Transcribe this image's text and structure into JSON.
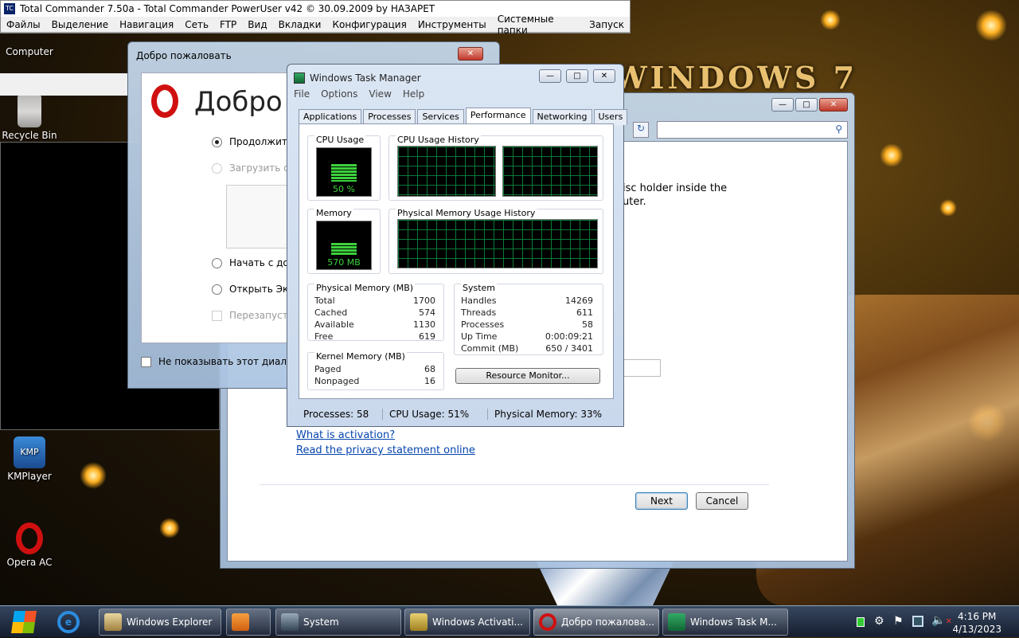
{
  "total_commander": {
    "title": "Total Commander 7.50a - Total Commander PowerUser v42 © 30.09.2009 by НАЗАРЕТ",
    "menu": [
      "Файлы",
      "Выделение",
      "Навигация",
      "Сеть",
      "FTP",
      "Вид",
      "Вкладки",
      "Конфигурация",
      "Инструменты",
      "Системные папки",
      "Запуск"
    ]
  },
  "desktop": {
    "icons": {
      "computer": "Computer",
      "recycle_bin": "Recycle Bin",
      "kmplayer": "KMPlayer",
      "opera": "Opera AC"
    },
    "kmp_badge": "KMP"
  },
  "opera_dialog": {
    "title": "Добро пожаловать",
    "heading": "Добро",
    "options": [
      "Продолжить",
      "Загрузить со",
      "Начать с дом",
      "Открыть Эксп",
      "Перезапусти"
    ],
    "dont_show": "Не показывать этот диалог"
  },
  "task_manager": {
    "title": "Windows Task Manager",
    "menu": [
      "File",
      "Options",
      "View",
      "Help"
    ],
    "tabs": [
      "Applications",
      "Processes",
      "Services",
      "Performance",
      "Networking",
      "Users"
    ],
    "cpu_usage_label": "CPU Usage",
    "cpu_usage_value": "50 %",
    "cpu_usage_percent": 50,
    "cpu_history_label": "CPU Usage History",
    "memory_label": "Memory",
    "memory_value": "570 MB",
    "memory_percent": 34,
    "phys_history_label": "Physical Memory Usage History",
    "physical_memory": {
      "title": "Physical Memory (MB)",
      "rows": [
        {
          "k": "Total",
          "v": "1700"
        },
        {
          "k": "Cached",
          "v": "574"
        },
        {
          "k": "Available",
          "v": "1130"
        },
        {
          "k": "Free",
          "v": "619"
        }
      ]
    },
    "kernel_memory": {
      "title": "Kernel Memory (MB)",
      "rows": [
        {
          "k": "Paged",
          "v": "68"
        },
        {
          "k": "Nonpaged",
          "v": "16"
        }
      ]
    },
    "system": {
      "title": "System",
      "rows": [
        {
          "k": "Handles",
          "v": "14269"
        },
        {
          "k": "Threads",
          "v": "611"
        },
        {
          "k": "Processes",
          "v": "58"
        },
        {
          "k": "Up Time",
          "v": "0:00:09:21"
        },
        {
          "k": "Commit (MB)",
          "v": "650 / 3401"
        }
      ]
    },
    "resource_monitor": "Resource Monitor...",
    "status": {
      "processes": "Processes: 58",
      "cpu": "CPU Usage: 51%",
      "memory": "Physical Memory: 33%"
    }
  },
  "activation": {
    "text_line1": "isc holder inside the",
    "text_line2": "uter.",
    "link_activation": "What is activation?",
    "link_privacy": "Read the privacy statement online",
    "next": "Next",
    "cancel": "Cancel"
  },
  "taskbar": {
    "items": [
      "Windows Explorer",
      "System",
      "Windows Activati...",
      "Добро пожалова...",
      "Windows Task M..."
    ],
    "time": "4:16 PM",
    "date": "4/13/2023"
  }
}
